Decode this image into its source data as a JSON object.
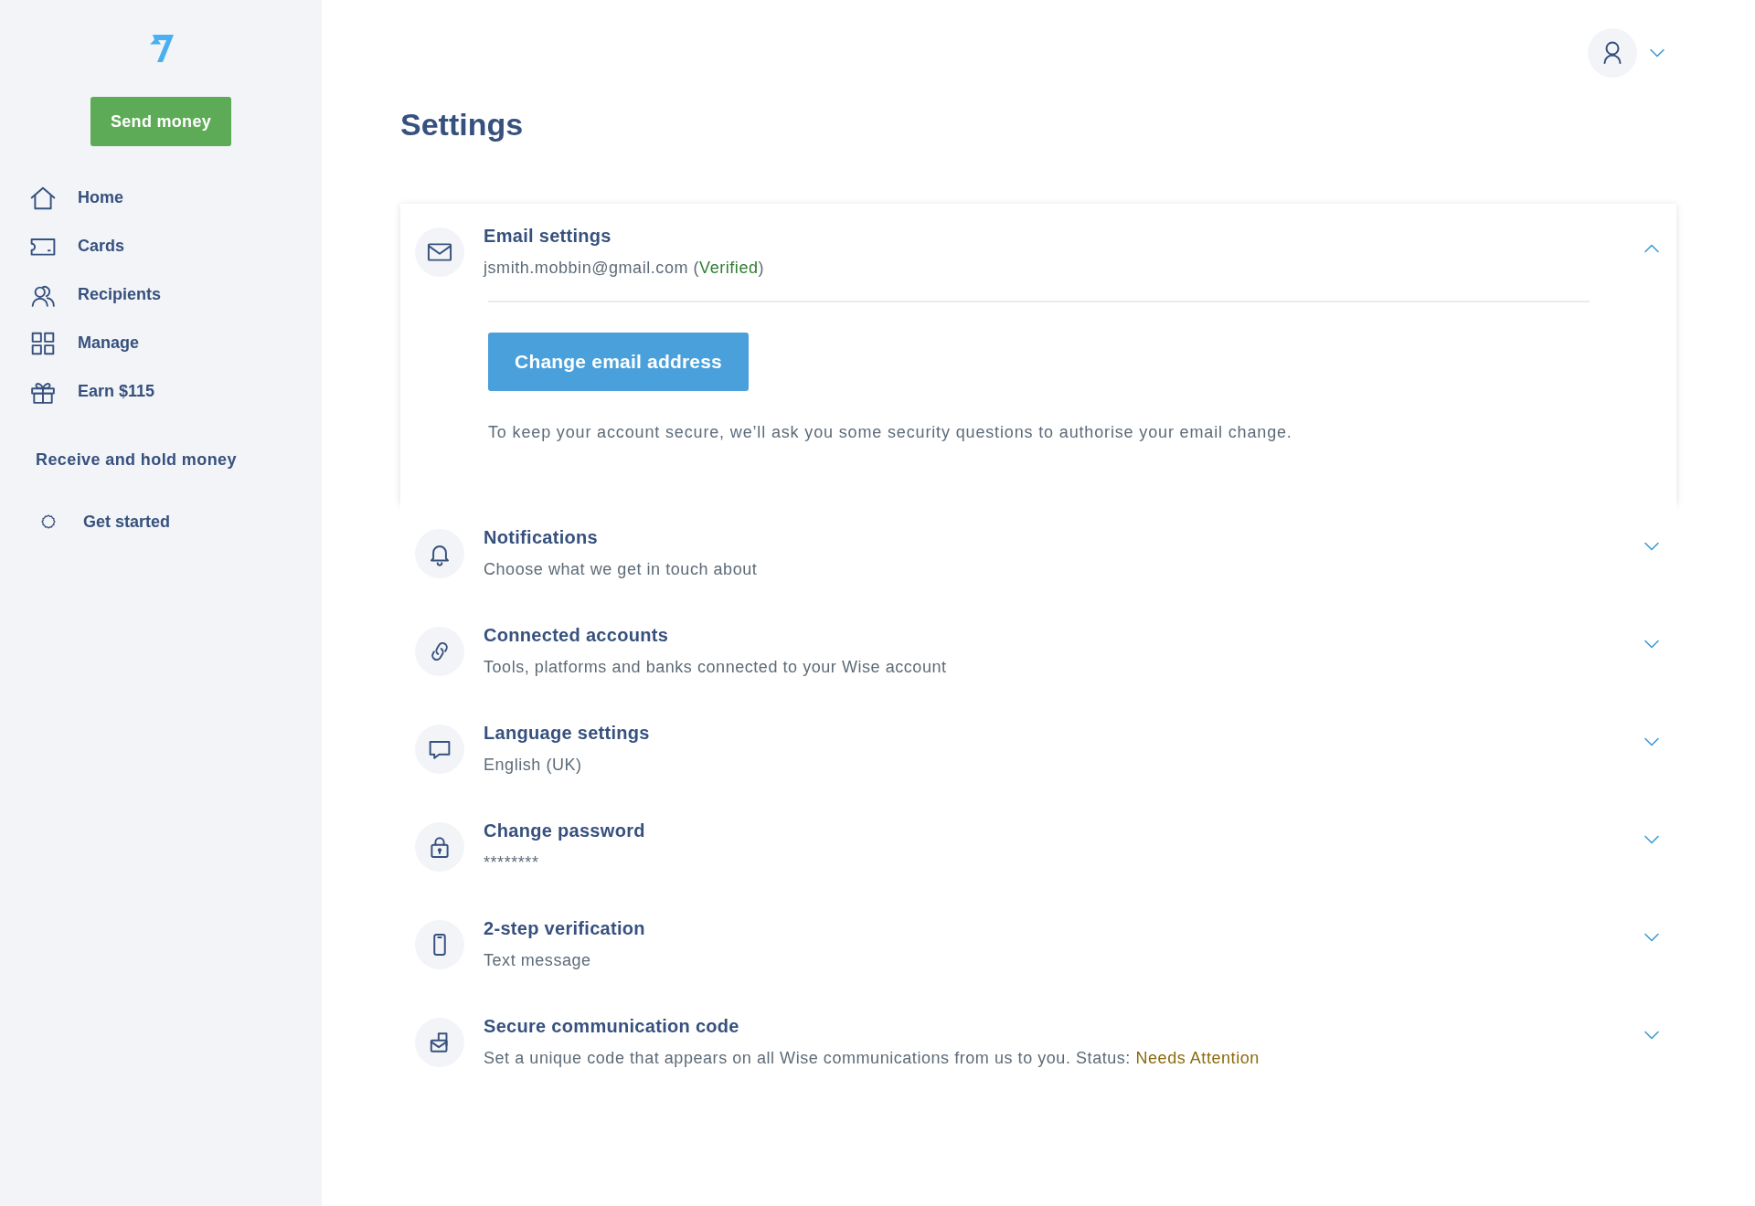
{
  "sidebar": {
    "send_button": "Send money",
    "nav": [
      {
        "label": "Home",
        "kind": "home",
        "selected": false
      },
      {
        "label": "Cards",
        "kind": "cards",
        "selected": false
      },
      {
        "label": "Recipients",
        "kind": "recipients",
        "selected": false
      },
      {
        "label": "Manage",
        "kind": "manage",
        "selected": false
      },
      {
        "label": "Earn $115",
        "kind": "earn",
        "selected": false
      }
    ],
    "section": {
      "title": "Receive and hold money",
      "items": [
        {
          "label": "Get started",
          "selected": false
        }
      ]
    }
  },
  "account_menu": {
    "expanded": false
  },
  "page_title": "Settings",
  "sections": [
    {
      "kind": "email",
      "title": "Email settings",
      "subtitle": [
        {
          "text": "jsmith.mobbin@gmail.com (",
          "kind": "plain"
        },
        {
          "text": "Verified",
          "kind": "success"
        },
        {
          "text": ")",
          "kind": "plain"
        }
      ],
      "expanded": true,
      "action": "Change email address",
      "note": "To keep your account secure, we’ll ask you some security questions to authorise your email change."
    },
    {
      "kind": "notifications",
      "title": "Notifications",
      "subtitle": [
        {
          "text": "Choose what we get in touch about",
          "kind": "plain"
        }
      ],
      "expanded": false
    },
    {
      "kind": "connections",
      "title": "Connected accounts",
      "subtitle": [
        {
          "text": "Tools, platforms and banks connected to your Wise account",
          "kind": "plain"
        }
      ],
      "expanded": false
    },
    {
      "kind": "language",
      "title": "Language settings",
      "subtitle": [
        {
          "text": "English (UK)",
          "kind": "plain"
        }
      ],
      "expanded": false
    },
    {
      "kind": "password",
      "title": "Change password",
      "subtitle": [
        {
          "text": "********",
          "kind": "plain"
        }
      ],
      "expanded": false
    },
    {
      "kind": "verification",
      "title": "2-step verification",
      "subtitle": [
        {
          "text": "Text message",
          "kind": "plain"
        }
      ],
      "expanded": false
    },
    {
      "kind": "code",
      "title": "Secure communication code",
      "subtitle": [
        {
          "text": "Set a unique code that appears on all Wise communications from us to you. Status: ",
          "kind": "plain"
        },
        {
          "text": "Needs Attention",
          "kind": "warning"
        }
      ],
      "expanded": false
    }
  ]
}
